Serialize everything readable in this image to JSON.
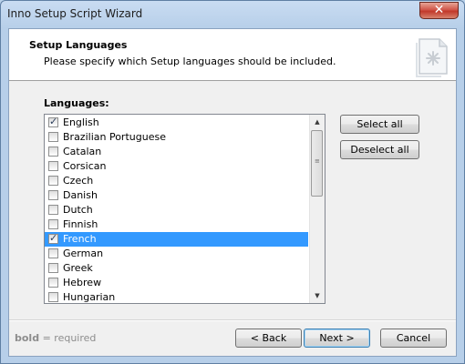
{
  "window": {
    "title": "Inno Setup Script Wizard",
    "close_glyph": "✕"
  },
  "header": {
    "title": "Setup Languages",
    "subtitle": "Please specify which Setup languages should be included.",
    "image_icon": "setup-document-icon"
  },
  "languages": {
    "label": "Languages:",
    "items": [
      {
        "label": "English",
        "checked": true,
        "selected": false
      },
      {
        "label": "Brazilian Portuguese",
        "checked": false,
        "selected": false
      },
      {
        "label": "Catalan",
        "checked": false,
        "selected": false
      },
      {
        "label": "Corsican",
        "checked": false,
        "selected": false
      },
      {
        "label": "Czech",
        "checked": false,
        "selected": false
      },
      {
        "label": "Danish",
        "checked": false,
        "selected": false
      },
      {
        "label": "Dutch",
        "checked": false,
        "selected": false
      },
      {
        "label": "Finnish",
        "checked": false,
        "selected": false
      },
      {
        "label": "French",
        "checked": true,
        "selected": true
      },
      {
        "label": "German",
        "checked": false,
        "selected": false
      },
      {
        "label": "Greek",
        "checked": false,
        "selected": false
      },
      {
        "label": "Hebrew",
        "checked": false,
        "selected": false
      },
      {
        "label": "Hungarian",
        "checked": false,
        "selected": false
      }
    ]
  },
  "buttons": {
    "select_all": "Select all",
    "deselect_all": "Deselect all",
    "back": "< Back",
    "next": "Next >",
    "cancel": "Cancel"
  },
  "hint": {
    "bold_word": "bold",
    "rest": " = required"
  },
  "colors": {
    "selection": "#3399ff",
    "title_bar": "#b7cfe9",
    "close_button": "#c1382a"
  }
}
